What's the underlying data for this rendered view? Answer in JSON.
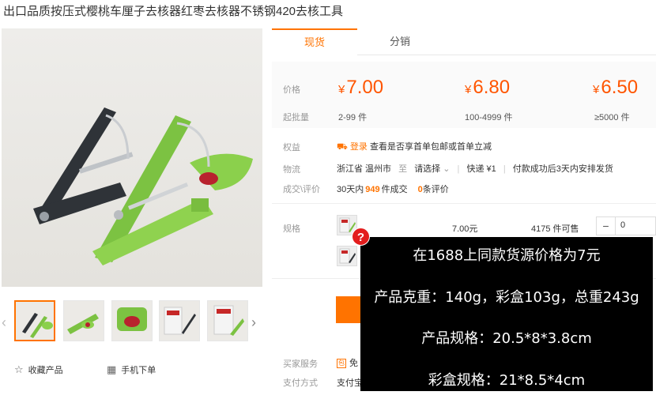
{
  "product": {
    "title": "出口品质按压式樱桃车厘子去核器红枣去核器不锈钢420去核工具"
  },
  "gallery": {
    "thumb_count": 5,
    "active_index": 0
  },
  "actions": {
    "favorite": "收藏产品",
    "mobile_order": "手机下单"
  },
  "tabs": [
    {
      "label": "现货",
      "active": true
    },
    {
      "label": "分销",
      "active": false
    }
  ],
  "pricing": {
    "price_label": "价格",
    "moq_label": "起批量",
    "currency": "¥",
    "tiers": [
      {
        "price": "7.00",
        "range": "2-99 件"
      },
      {
        "price": "6.80",
        "range": "100-4999 件"
      },
      {
        "price": "6.50",
        "range": "≥5000 件"
      }
    ]
  },
  "benefits": {
    "label": "权益",
    "tag": "登录",
    "text": "查看是否享首单包邮或首单立减"
  },
  "logistics": {
    "label": "物流",
    "origin": "浙江省 温州市",
    "to": "至",
    "destination": "请选择",
    "carrier": "快递 ¥1",
    "dispatch": "付款成功后3天内安排发货"
  },
  "deals": {
    "label": "成交\\评价",
    "prefix": "30天内",
    "count": "949",
    "suffix": "件成交",
    "reviews": "0",
    "reviews_suffix": "条评价"
  },
  "spec": {
    "label": "规格",
    "price": "7.00元",
    "stock": "4175 件可售",
    "quantity": "0",
    "minus": "−"
  },
  "service": {
    "buyer_label": "买家服务",
    "buyer_icon": "包",
    "buyer_text": "免",
    "pay_label": "支付方式",
    "pay_text": "支付宝"
  },
  "overlay": {
    "badge": "?",
    "lines": [
      "在1688上同款货源价格为7元",
      "产品克重：140g，彩盒103g，总重243g",
      "产品规格：20.5*8*3.8cm",
      "彩盒规格：21*8.5*4cm"
    ]
  },
  "colors": {
    "accent": "#ff7300",
    "price": "#ff5500",
    "tool_green": "#7cc242",
    "tool_dark": "#2f3338"
  }
}
